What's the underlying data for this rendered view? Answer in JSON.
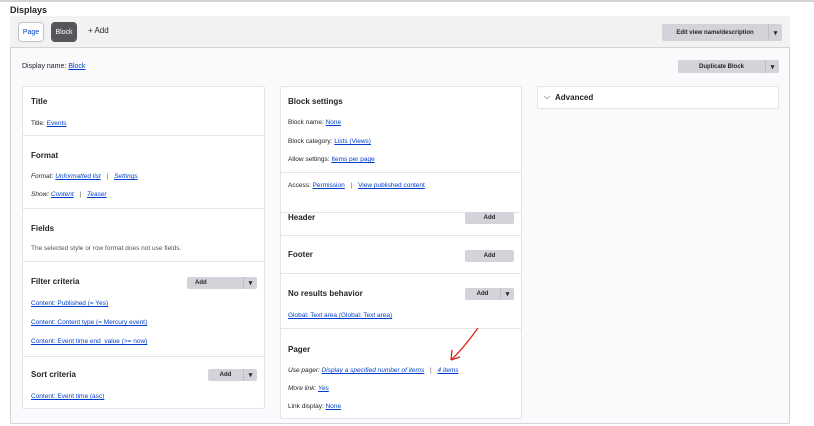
{
  "page": {
    "title": "Displays"
  },
  "tabs": {
    "page": "Page",
    "block": "Block",
    "add": "+ Add"
  },
  "header": {
    "edit_view": "Edit view name/description",
    "duplicate": "Duplicate Block"
  },
  "display_name": {
    "label": "Display name:",
    "value": "Block"
  },
  "col1": {
    "title": {
      "heading": "Title",
      "label": "Title:",
      "value": "Events"
    },
    "format": {
      "heading": "Format",
      "format_label": "Format:",
      "format_value": "Unformatted list",
      "settings": "Settings",
      "show_label": "Show:",
      "show_value": "Content",
      "teaser": "Teaser"
    },
    "fields": {
      "heading": "Fields",
      "note": "The selected style or row format does not use fields."
    },
    "filter": {
      "heading": "Filter criteria",
      "add": "Add",
      "items": [
        "Content: Published (= Yes)",
        "Content: Content type (= Mercury event)",
        "Content: Event time end_value (>= now)"
      ]
    },
    "sort": {
      "heading": "Sort criteria",
      "add": "Add",
      "item": "Content: Event time (asc)"
    }
  },
  "col2": {
    "block_settings": {
      "heading": "Block settings",
      "name_label": "Block name:",
      "name_value": "None",
      "category_label": "Block category:",
      "category_value": "Lists (Views)",
      "allow_label": "Allow settings:",
      "allow_value": "Items per page",
      "access_label": "Access:",
      "access_value": "Permission",
      "access_value2": "View published content"
    },
    "header": {
      "heading": "Header",
      "add": "Add"
    },
    "footer": {
      "heading": "Footer",
      "add": "Add"
    },
    "no_results": {
      "heading": "No results behavior",
      "add": "Add",
      "item": "Global: Text area (Global: Text area)"
    },
    "pager": {
      "heading": "Pager",
      "use_label": "Use pager:",
      "use_value": "Display a specified number of items",
      "items_value": "4 items",
      "more_label": "More link:",
      "more_value": "Yes",
      "link_label": "Link display:",
      "link_value": "None"
    }
  },
  "advanced": {
    "label": "Advanced"
  },
  "colors": {
    "link": "#003ecc",
    "active_tab": "#55565b",
    "button": "#d3d4d9",
    "annotation": "#e0201a"
  },
  "icons": {
    "chevron": "chevron-down-icon",
    "advanced": "chevron-right-icon"
  }
}
